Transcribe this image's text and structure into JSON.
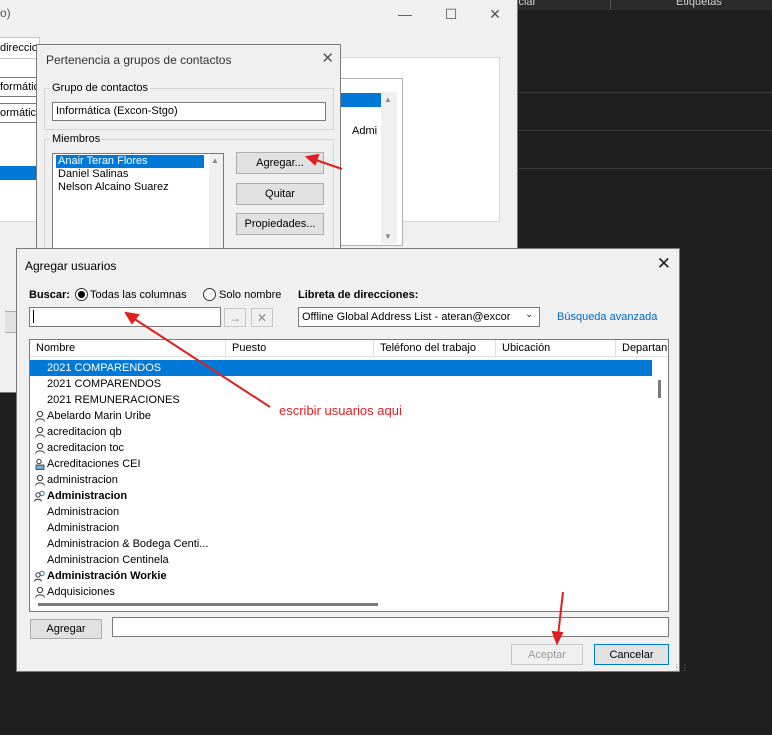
{
  "background": {
    "header_cols": [
      "Iniciar",
      "Etiquetas"
    ],
    "header_visible": [
      "icial",
      "Etiquetas"
    ]
  },
  "back_window": {
    "title_fragment": "o)",
    "labels": [
      "direccio",
      "formátic",
      "ormátic"
    ],
    "right_text": "Admi"
  },
  "pertenencia": {
    "title": "Pertenencia a grupos de contactos",
    "group_label": "Grupo de contactos",
    "group_value": "Informática (Excon-Stgo)",
    "members_label": "Miembros",
    "members": [
      "Anair Teran Flores",
      "Daniel Salinas",
      "Nelson Alcaino Suarez"
    ],
    "selected_member": 0,
    "buttons": {
      "add": "Agregar...",
      "remove": "Quitar",
      "properties": "Propiedades..."
    }
  },
  "add_users": {
    "title": "Agregar usuarios",
    "search_label": "Buscar:",
    "radio_all": "Todas las columnas",
    "radio_name": "Solo nombre",
    "radio_selected": "all",
    "search_value": "",
    "address_book_label": "Libreta de direcciones:",
    "address_book_value": "Offline Global Address List - ateran@excor",
    "advanced_search": "Búsqueda avanzada",
    "columns": [
      "Nombre",
      "Puesto",
      "Teléfono del trabajo",
      "Ubicación",
      "Departan"
    ],
    "rows": [
      {
        "name": "2021 COMPARENDOS",
        "icon": "none",
        "bold": false
      },
      {
        "name": "2021 COMPARENDOS",
        "icon": "none",
        "bold": false
      },
      {
        "name": "2021 REMUNERACIONES",
        "icon": "none",
        "bold": false
      },
      {
        "name": "Abelardo Marin Uribe",
        "icon": "user",
        "bold": false
      },
      {
        "name": "acreditacion qb",
        "icon": "user",
        "bold": false
      },
      {
        "name": "acreditacion toc",
        "icon": "user",
        "bold": false
      },
      {
        "name": "Acreditaciones CEI",
        "icon": "room",
        "bold": false
      },
      {
        "name": "administracion",
        "icon": "user",
        "bold": false
      },
      {
        "name": "Administracion",
        "icon": "group",
        "bold": true
      },
      {
        "name": "Administracion",
        "icon": "none",
        "bold": false
      },
      {
        "name": "Administracion",
        "icon": "none",
        "bold": false
      },
      {
        "name": "Administracion & Bodega Centi...",
        "icon": "none",
        "bold": false
      },
      {
        "name": "Administracion Centinela",
        "icon": "none",
        "bold": false
      },
      {
        "name": "Administración Workie",
        "icon": "group",
        "bold": true
      },
      {
        "name": "Adquisiciones",
        "icon": "user",
        "bold": false
      }
    ],
    "selected_row": 0,
    "add_button": "Agregar",
    "add_value": "",
    "ok_button": "Aceptar",
    "cancel_button": "Cancelar"
  },
  "annotation": {
    "text": "escribir usuarios aqui",
    "color": "#e01f1f"
  },
  "colors": {
    "selection": "#0078d7",
    "link": "#0066cc"
  }
}
